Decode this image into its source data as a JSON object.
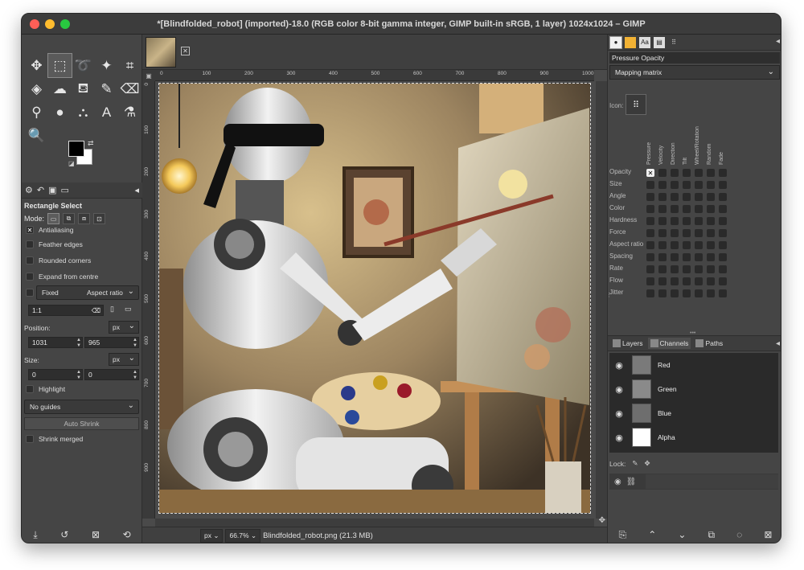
{
  "window": {
    "title": "*[Blindfolded_robot] (imported)-18.0 (RGB color 8-bit gamma integer, GIMP built-in sRGB, 1 layer) 1024x1024 – GIMP"
  },
  "colors": {
    "accent": "#ffffff",
    "window_bg": "#454545",
    "titlebar_bg": "#3c3c3c"
  },
  "toolbox": {
    "tools": [
      {
        "name": "move-tool-icon",
        "glyph": "✥"
      },
      {
        "name": "rectangle-select-tool-icon",
        "glyph": "⬚",
        "active": true
      },
      {
        "name": "lasso-tool-icon",
        "glyph": "➰"
      },
      {
        "name": "fuzzy-select-tool-icon",
        "glyph": "✦"
      },
      {
        "name": "crop-tool-icon",
        "glyph": "⌗"
      },
      {
        "name": "transform-tool-icon",
        "glyph": "◈"
      },
      {
        "name": "warp-tool-icon",
        "glyph": "☁"
      },
      {
        "name": "bucket-fill-tool-icon",
        "glyph": "⛾"
      },
      {
        "name": "paintbrush-tool-icon",
        "glyph": "✎"
      },
      {
        "name": "eraser-tool-icon",
        "glyph": "⌫"
      },
      {
        "name": "clone-tool-icon",
        "glyph": "⚲"
      },
      {
        "name": "smudge-tool-icon",
        "glyph": "●"
      },
      {
        "name": "paths-tool-icon",
        "glyph": "⛬"
      },
      {
        "name": "text-tool-icon",
        "glyph": "A"
      },
      {
        "name": "color-picker-tool-icon",
        "glyph": "⚗"
      },
      {
        "name": "zoom-tool-icon",
        "glyph": "🔍"
      }
    ]
  },
  "tool_options": {
    "title": "Rectangle Select",
    "mode_label": "Mode:",
    "antialiasing": "Antialiasing",
    "feather_edges": "Feather edges",
    "rounded_corners": "Rounded corners",
    "expand_from_centre": "Expand from centre",
    "fixed_label": "Fixed",
    "fixed_value": "Aspect ratio",
    "ratio_value": "1:1",
    "position_label": "Position:",
    "position_unit": "px",
    "position_x": "1031",
    "position_y": "965",
    "size_label": "Size:",
    "size_unit": "px",
    "size_w": "0",
    "size_h": "0",
    "highlight": "Highlight",
    "guides_value": "No guides",
    "auto_shrink": "Auto Shrink",
    "shrink_merged": "Shrink merged"
  },
  "ruler": {
    "h_labels": [
      "0",
      "100",
      "200",
      "300",
      "400",
      "500",
      "600",
      "700",
      "800",
      "900",
      "1000"
    ],
    "v_labels": [
      "0",
      "100",
      "200",
      "300",
      "400",
      "500",
      "600",
      "700",
      "800",
      "900"
    ]
  },
  "status": {
    "unit": "px",
    "zoom": "66.7%",
    "file": "Blindfolded_robot.png (21.3 MB)"
  },
  "dynamics": {
    "name": "Pressure Opacity",
    "mapping": "Mapping matrix",
    "icon_label": "Icon:",
    "columns": [
      "Pressure",
      "Velocity",
      "Direction",
      "Tilt",
      "Wheel/Rotation",
      "Random",
      "Fade"
    ],
    "rows": [
      "Opacity",
      "Size",
      "Angle",
      "Color",
      "Hardness",
      "Force",
      "Aspect ratio",
      "Spacing",
      "Rate",
      "Flow",
      "Jitter"
    ]
  },
  "layers_panel": {
    "tabs": [
      "Layers",
      "Channels",
      "Paths"
    ],
    "channels": [
      {
        "name": "Red",
        "thumb": "#7a7a7a"
      },
      {
        "name": "Green",
        "thumb": "#8a8a8a"
      },
      {
        "name": "Blue",
        "thumb": "#6e6e6e"
      },
      {
        "name": "Alpha",
        "thumb": "#ffffff"
      }
    ],
    "lock_label": "Lock:"
  }
}
